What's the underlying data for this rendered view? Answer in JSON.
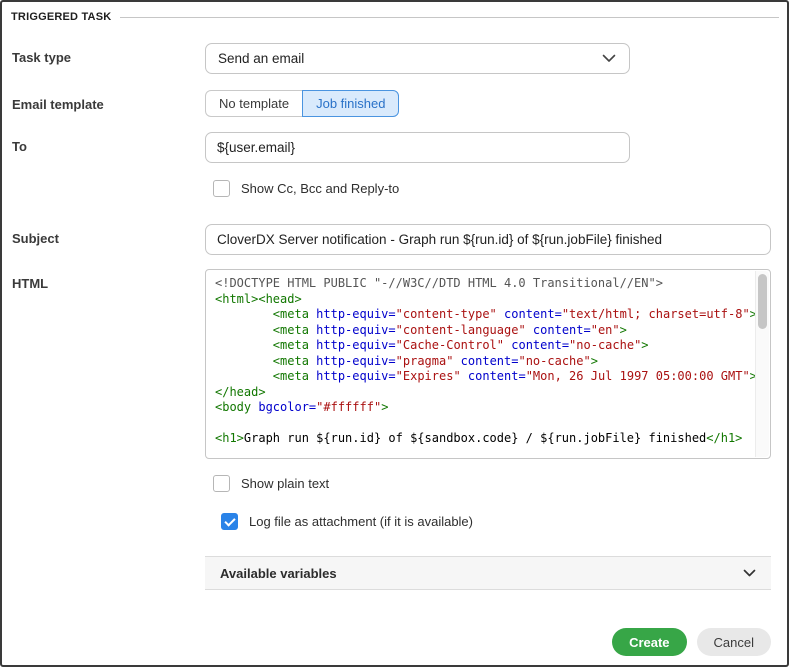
{
  "section": {
    "title": "TRIGGERED TASK"
  },
  "form": {
    "task_type": {
      "label": "Task type",
      "value": "Send an email"
    },
    "email_template": {
      "label": "Email template",
      "options": [
        {
          "label": "No template",
          "selected": false
        },
        {
          "label": "Job finished",
          "selected": true
        }
      ]
    },
    "to": {
      "label": "To",
      "value": "${user.email}"
    },
    "show_cc": {
      "label": "Show Cc, Bcc and Reply-to",
      "checked": false
    },
    "subject": {
      "label": "Subject",
      "value": "CloverDX Server notification - Graph run ${run.id} of ${run.jobFile} finished"
    },
    "html": {
      "label": "HTML",
      "lines": [
        [
          {
            "t": "meta",
            "s": "<!DOCTYPE HTML PUBLIC \"-//W3C//DTD HTML 4.0 Transitional//EN\">"
          }
        ],
        [
          {
            "t": "tag",
            "s": "<html><head>"
          }
        ],
        [
          {
            "t": "text",
            "s": "        "
          },
          {
            "t": "tag",
            "s": "<meta "
          },
          {
            "t": "attr",
            "s": "http-equiv="
          },
          {
            "t": "str",
            "s": "\"content-type\""
          },
          {
            "t": "text",
            "s": " "
          },
          {
            "t": "attr",
            "s": "content="
          },
          {
            "t": "str",
            "s": "\"text/html; charset=utf-8\""
          },
          {
            "t": "tag",
            "s": ">"
          }
        ],
        [
          {
            "t": "text",
            "s": "        "
          },
          {
            "t": "tag",
            "s": "<meta "
          },
          {
            "t": "attr",
            "s": "http-equiv="
          },
          {
            "t": "str",
            "s": "\"content-language\""
          },
          {
            "t": "text",
            "s": " "
          },
          {
            "t": "attr",
            "s": "content="
          },
          {
            "t": "str",
            "s": "\"en\""
          },
          {
            "t": "tag",
            "s": ">"
          }
        ],
        [
          {
            "t": "text",
            "s": "        "
          },
          {
            "t": "tag",
            "s": "<meta "
          },
          {
            "t": "attr",
            "s": "http-equiv="
          },
          {
            "t": "str",
            "s": "\"Cache-Control\""
          },
          {
            "t": "text",
            "s": " "
          },
          {
            "t": "attr",
            "s": "content="
          },
          {
            "t": "str",
            "s": "\"no-cache\""
          },
          {
            "t": "tag",
            "s": ">"
          }
        ],
        [
          {
            "t": "text",
            "s": "        "
          },
          {
            "t": "tag",
            "s": "<meta "
          },
          {
            "t": "attr",
            "s": "http-equiv="
          },
          {
            "t": "str",
            "s": "\"pragma\""
          },
          {
            "t": "text",
            "s": " "
          },
          {
            "t": "attr",
            "s": "content="
          },
          {
            "t": "str",
            "s": "\"no-cache\""
          },
          {
            "t": "tag",
            "s": ">"
          }
        ],
        [
          {
            "t": "text",
            "s": "        "
          },
          {
            "t": "tag",
            "s": "<meta "
          },
          {
            "t": "attr",
            "s": "http-equiv="
          },
          {
            "t": "str",
            "s": "\"Expires\""
          },
          {
            "t": "text",
            "s": " "
          },
          {
            "t": "attr",
            "s": "content="
          },
          {
            "t": "str",
            "s": "\"Mon, 26 Jul 1997 05:00:00 GMT\""
          },
          {
            "t": "tag",
            "s": ">"
          }
        ],
        [
          {
            "t": "tag",
            "s": "</head>"
          }
        ],
        [
          {
            "t": "tag",
            "s": "<body "
          },
          {
            "t": "attr",
            "s": "bgcolor="
          },
          {
            "t": "str",
            "s": "\"#ffffff\""
          },
          {
            "t": "tag",
            "s": ">"
          }
        ],
        [],
        [
          {
            "t": "tag",
            "s": "<h1>"
          },
          {
            "t": "text",
            "s": "Graph run ${run.id} of ${sandbox.code} / ${run.jobFile} finished"
          },
          {
            "t": "tag",
            "s": "</h1>"
          }
        ]
      ]
    },
    "show_plain": {
      "label": "Show plain text",
      "checked": false
    },
    "log_attachment": {
      "label": "Log file as attachment (if it is available)",
      "checked": true
    },
    "available_variables": {
      "label": "Available variables"
    }
  },
  "actions": {
    "create_label": "Create",
    "cancel_label": "Cancel"
  },
  "colors": {
    "accent_blue": "#2a83e8",
    "selected_toggle_bg": "#d9eafc",
    "selected_toggle_border": "#4a94e0",
    "create_green": "#37a647",
    "code_tag": "#117700",
    "code_attribute": "#0000cc",
    "code_string": "#aa1111",
    "code_doctype": "#555555"
  }
}
